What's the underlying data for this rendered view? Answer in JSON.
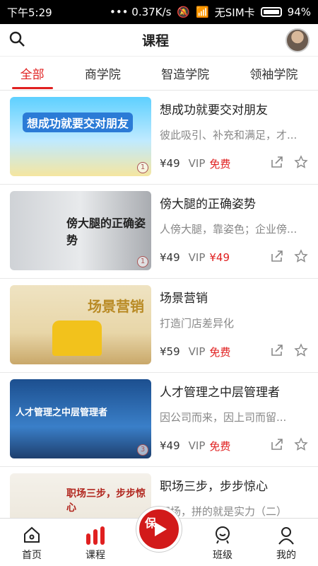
{
  "status": {
    "time": "下午5:29",
    "speed": "0.37K/s",
    "carrier": "无SIM卡",
    "battery": "94%"
  },
  "header": {
    "title": "课程"
  },
  "tabs": [
    "全部",
    "商学院",
    "智造学院",
    "领袖学院"
  ],
  "courses": [
    {
      "title": "想成功就要交对朋友",
      "desc": "彼此吸引、补充和满足，才...",
      "price": "¥49",
      "vip_label": "VIP",
      "vip_value": "免费",
      "thumb_text": "想成功就要交对朋友",
      "badge": "1"
    },
    {
      "title": "傍大腿的正确姿势",
      "desc": "人傍大腿，靠姿色；企业傍...",
      "price": "¥49",
      "vip_label": "VIP",
      "vip_value": "¥49",
      "thumb_text": "傍大腿的正确姿势",
      "badge": "1"
    },
    {
      "title": "场景营销",
      "desc": "打造门店差异化",
      "price": "¥59",
      "vip_label": "VIP",
      "vip_value": "免费",
      "thumb_text": "场景营销",
      "badge": ""
    },
    {
      "title": "人才管理之中层管理者",
      "desc": "因公司而来，因上司而留...",
      "price": "¥49",
      "vip_label": "VIP",
      "vip_value": "免费",
      "thumb_text": "人才管理之中层管理者",
      "badge": "3"
    },
    {
      "title": "职场三步，步步惊心",
      "desc": "职场，拼的就是实力（二）",
      "price": "",
      "vip_label": "",
      "vip_value": "",
      "thumb_text": "职场三步，步步惊心",
      "badge": ""
    }
  ],
  "nav": {
    "home": "首页",
    "courses": "课程",
    "center": "保",
    "class": "班级",
    "mine": "我的"
  },
  "colors": {
    "accent": "#e02020"
  }
}
